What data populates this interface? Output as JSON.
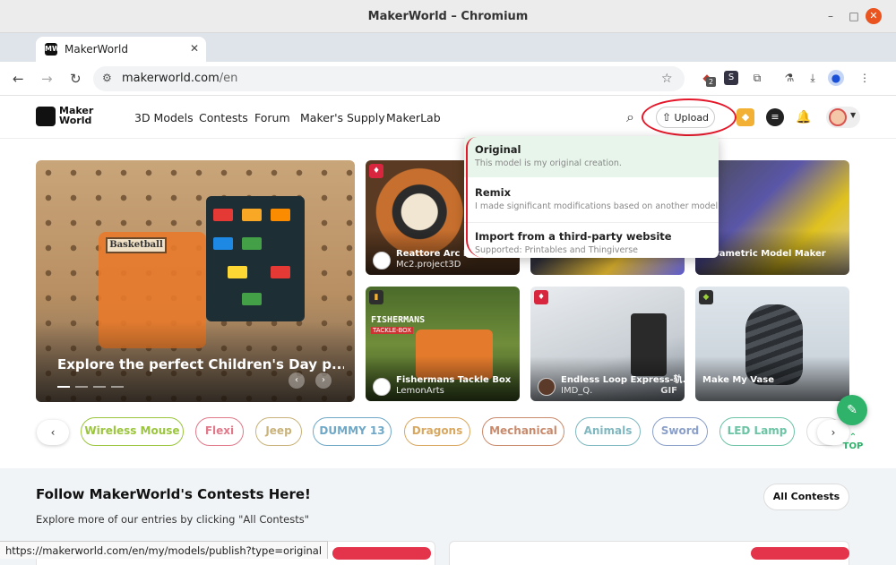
{
  "window": {
    "title": "MakerWorld – Chromium"
  },
  "browser": {
    "tab_label": "MakerWorld",
    "tab_favicon": "MW",
    "url_host": "makerworld.com",
    "url_path": "/en",
    "status_url": "https://makerworld.com/en/my/models/publish?type=original",
    "ext_badge": "2"
  },
  "header": {
    "logo_line1": "Maker",
    "logo_line2": "World",
    "nav": [
      "3D Models",
      "Contests",
      "Forum",
      "Maker's Supply",
      "MakerLab"
    ],
    "upload_label": "Upload"
  },
  "hero": {
    "caption": "Explore the perfect Children's Day p...",
    "sign": "Basketball"
  },
  "cards": [
    {
      "caption": "Reattore Arc Mk...",
      "sub": "Mc2.project3D",
      "badge_color": "#d7263d",
      "badge": "♦"
    },
    {
      "caption": "Parametric Model Maker",
      "sub": "",
      "badge_color": "",
      "badge": ""
    },
    {
      "caption": "Fishermans Tackle Box",
      "sub": "LemonArts",
      "badge_color": "#2e2e2e",
      "badge": "▮"
    },
    {
      "caption": "Endless Loop Express-轨...",
      "sub": "IMD_Q.",
      "gif": "GIF",
      "badge_color": "#d7263d",
      "badge": "♦"
    },
    {
      "caption": "Make My Vase",
      "sub": "",
      "badge_color": "#2e2e2e",
      "badge": "◆"
    }
  ],
  "fishermans_label": "FISHERMANS",
  "fishermans_sub": "TACKLE-BOX",
  "upload_menu": [
    {
      "title": "Original",
      "desc": "This model is my original creation."
    },
    {
      "title": "Remix",
      "desc": "I made significant modifications based on another model."
    },
    {
      "title": "Import from a third-party website",
      "desc": "Supported: Printables and Thingiverse"
    }
  ],
  "chips": [
    {
      "label": "Wireless Mouse",
      "color": "#9bc53d"
    },
    {
      "label": "Flexi",
      "color": "#e07a8a"
    },
    {
      "label": "Jeep",
      "color": "#c9b37a"
    },
    {
      "label": "DUMMY 13",
      "color": "#6fa8c7"
    },
    {
      "label": "Dragons",
      "color": "#d9a860"
    },
    {
      "label": "Mechanical",
      "color": "#c98a6c"
    },
    {
      "label": "Animals",
      "color": "#7fb8c0"
    },
    {
      "label": "Sword",
      "color": "#8a9fc9"
    },
    {
      "label": "LED Lamp",
      "color": "#6cc4a4"
    }
  ],
  "top_label": "TOP",
  "contests": {
    "title": "Follow MakerWorld's Contests Here!",
    "subtitle": "Explore more of our entries by clicking \"All Contests\"",
    "button": "All Contests"
  }
}
